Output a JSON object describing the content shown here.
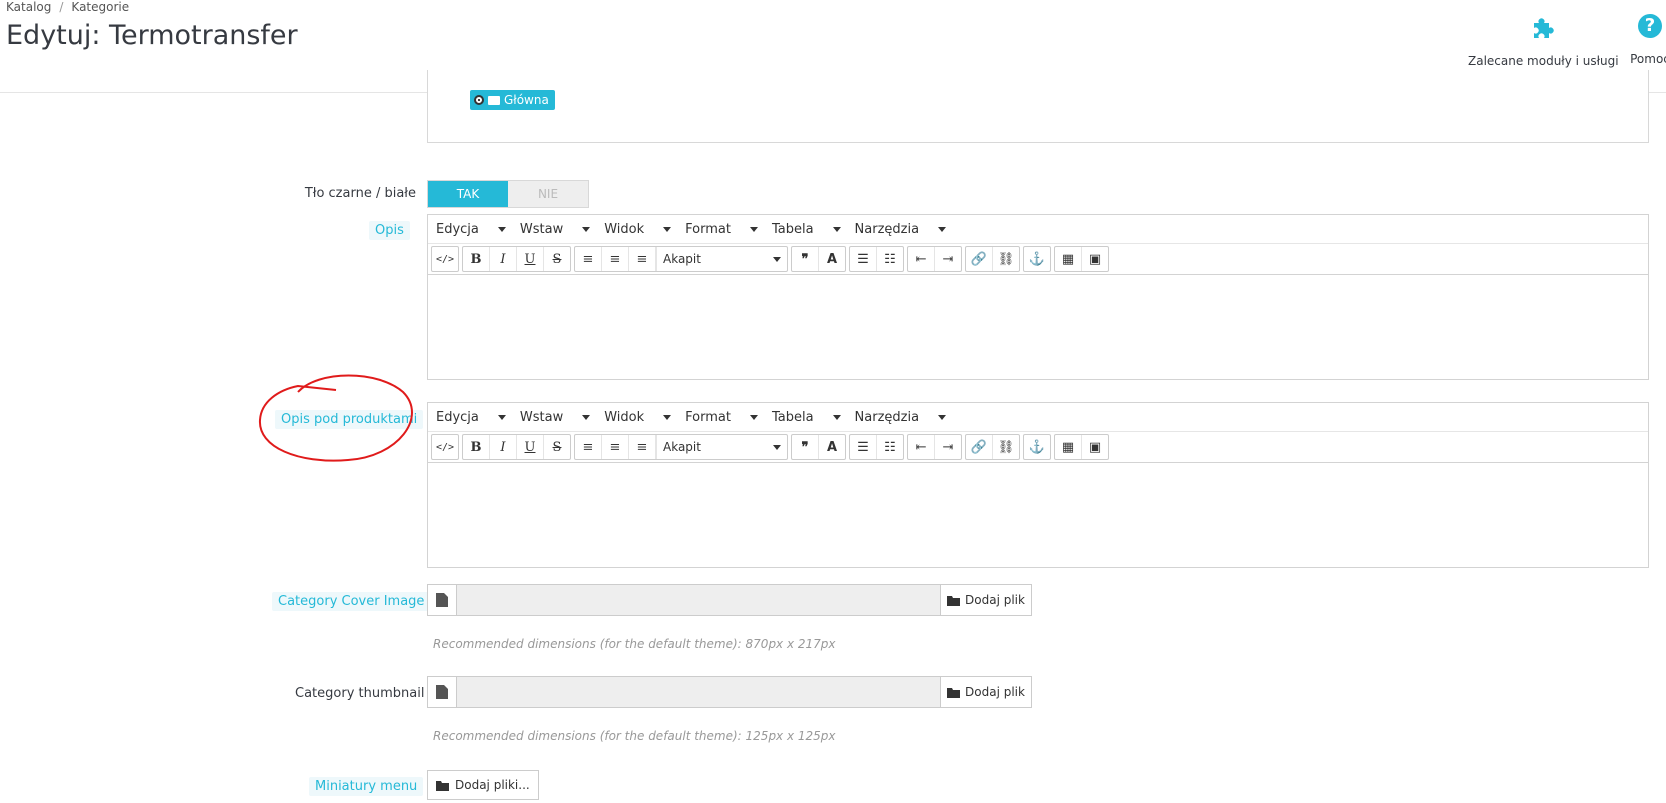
{
  "breadcrumb": [
    "Katalog",
    "Kategorie"
  ],
  "page_title": "Edytuj: Termotransfer",
  "toolbar": {
    "modules_label": "Zalecane moduły i usługi",
    "modules_icon": "puzzle-icon",
    "help_label": "Pomoc",
    "help_icon": "question-circle-icon",
    "help_glyph": "?"
  },
  "tree": {
    "selected_label": "Główna"
  },
  "bw_background": {
    "label": "Tło czarne / białe",
    "on": "TAK",
    "off": "NIE",
    "value": "TAK"
  },
  "editor_menu": [
    "Edycja",
    "Wstaw",
    "Widok",
    "Format",
    "Tabela",
    "Narzędzia"
  ],
  "editor_toolbar": {
    "format_select": "Akapit",
    "buttons": [
      "code-icon",
      "bold-icon",
      "italic-icon",
      "underline-icon",
      "strikethrough-icon",
      "align-left-icon",
      "align-center-icon",
      "align-right-icon",
      "blockquote-icon",
      "text-color-icon",
      "bullet-list-icon",
      "numbered-list-icon",
      "outdent-icon",
      "indent-icon",
      "link-icon",
      "unlink-icon",
      "anchor-icon",
      "media-icon",
      "image-icon"
    ],
    "glyphs": {
      "bold": "B",
      "italic": "I",
      "underline": "U",
      "strike": "S",
      "quote": "❞",
      "color": "A"
    }
  },
  "fields": {
    "opis": "Opis",
    "opis_pod": "Opis pod produktami",
    "cover_image": "Category Cover Image",
    "cover_note": "Recommended dimensions (for the default theme): 870px x 217px",
    "thumbnail": "Category thumbnail",
    "thumbnail_note": "Recommended dimensions (for the default theme): 125px x 125px",
    "menu_thumbs": "Miniatury menu"
  },
  "buttons": {
    "add_file": "Dodaj plik",
    "add_files": "Dodaj pliki..."
  },
  "colors": {
    "accent": "#25b9d7",
    "annotation": "#e01b1b"
  }
}
